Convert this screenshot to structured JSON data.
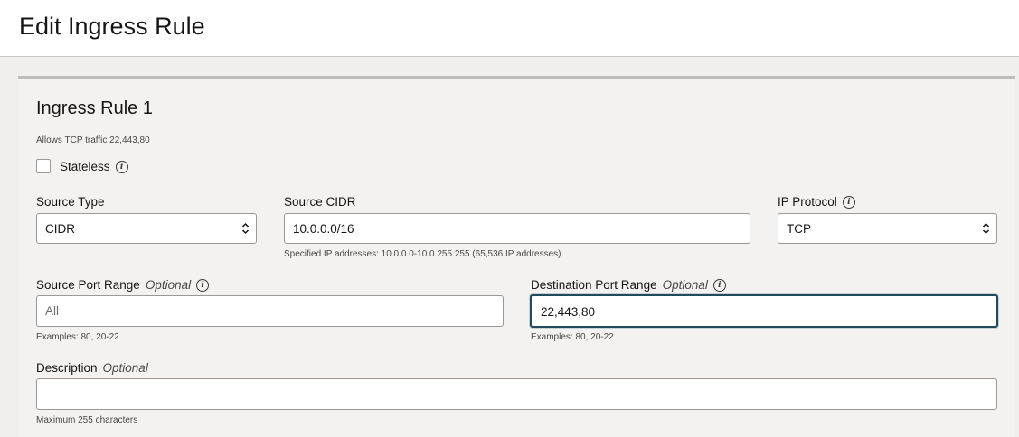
{
  "header": {
    "title": "Edit Ingress Rule"
  },
  "rule": {
    "title": "Ingress Rule 1",
    "summary": "Allows TCP traffic 22,443,80",
    "stateless_label": "Stateless",
    "stateless_checked": false
  },
  "source_type": {
    "label": "Source Type",
    "value": "CIDR"
  },
  "source_cidr": {
    "label": "Source CIDR",
    "value": "10.0.0.0/16",
    "help": "Specified IP addresses: 10.0.0.0-10.0.255.255 (65,536 IP addresses)"
  },
  "ip_protocol": {
    "label": "IP Protocol",
    "value": "TCP"
  },
  "source_port": {
    "label": "Source Port Range",
    "optional": "Optional",
    "placeholder": "All",
    "help": "Examples: 80, 20-22"
  },
  "dest_port": {
    "label": "Destination Port Range",
    "optional": "Optional",
    "value": "22,443,80",
    "help": "Examples: 80, 20-22"
  },
  "description": {
    "label": "Description",
    "optional": "Optional",
    "value": "",
    "help": "Maximum 255 characters"
  }
}
